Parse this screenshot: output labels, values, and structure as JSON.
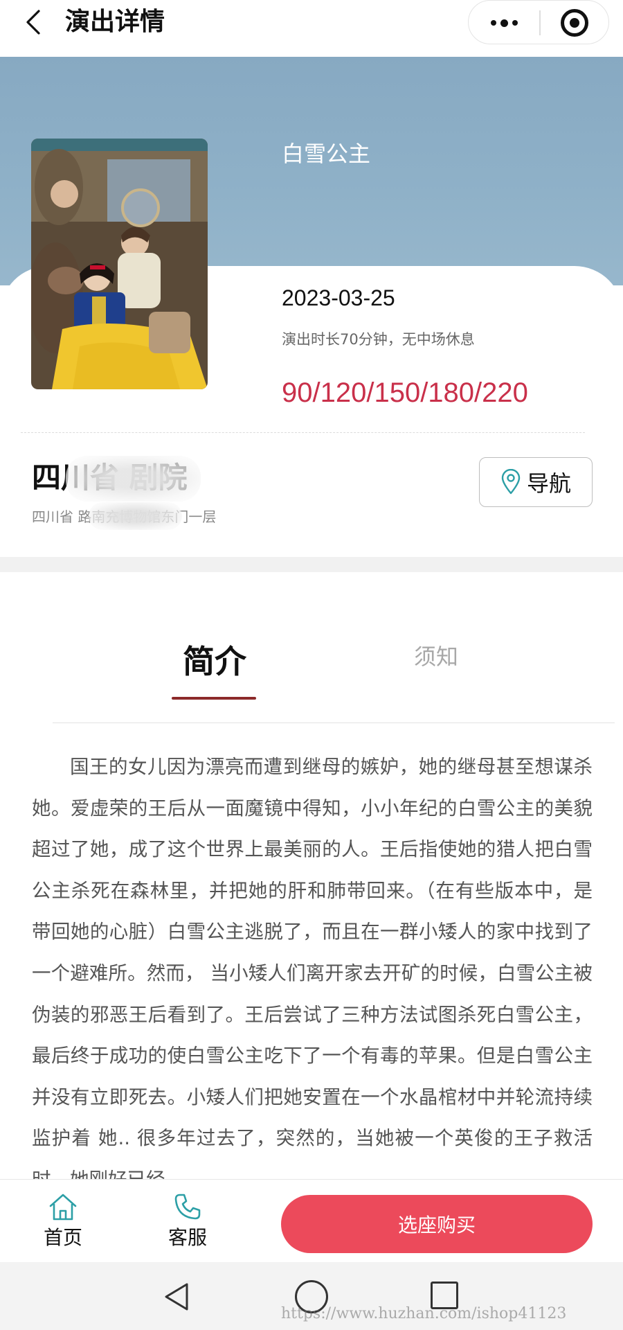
{
  "navbar": {
    "title": "演出详情"
  },
  "show": {
    "title": "白雪公主",
    "date": "2023-03-25",
    "duration": "演出时长70分钟，无中场休息",
    "price": "90/120/150/180/220"
  },
  "venue": {
    "name": "四川省 剧院",
    "address": "四川省 路南充博物馆东门一层",
    "nav_label": "导航"
  },
  "tabs": {
    "intro_label": "简介",
    "notice_label": "须知"
  },
  "description": "国王的女儿因为漂亮而遭到继母的嫉妒，她的继母甚至想谋杀她。爱虚荣的王后从一面魔镜中得知，小小年纪的白雪公主的美貌超过了她，成了这个世界上最美丽的人。王后指使她的猎人把白雪公主杀死在森林里，并把她的肝和肺带回来。（在有些版本中，是带回她的心脏）白雪公主逃脱了，而且在一群小矮人的家中找到了一个避难所。然而， 当小矮人们离开家去开矿的时候，白雪公主被伪装的邪恶王后看到了。王后尝试了三种方法试图杀死白雪公主，最后终于成功的使白雪公主吃下了一个有毒的苹果。但是白雪公主并没有立即死去。小矮人们把她安置在一个水晶棺材中并轮流持续监护着 她.. 很多年过去了，突然的，当她被一个英俊的王子救活时，她刚好已经",
  "bottom_bar": {
    "home_label": "首页",
    "service_label": "客服",
    "buy_label": "选座购买"
  },
  "watermark": "https://www.huzhan.com/ishop41123",
  "icons": {
    "back": "chevron-left-icon",
    "more": "more-dots-icon",
    "close": "target-close-icon",
    "location": "location-pin-icon",
    "home": "home-icon",
    "phone": "phone-icon"
  },
  "colors": {
    "hero": "#8fb1c8",
    "price": "#c9304a",
    "buy_button": "#ec4a5b",
    "tab_indicator": "#8c2a2a"
  }
}
